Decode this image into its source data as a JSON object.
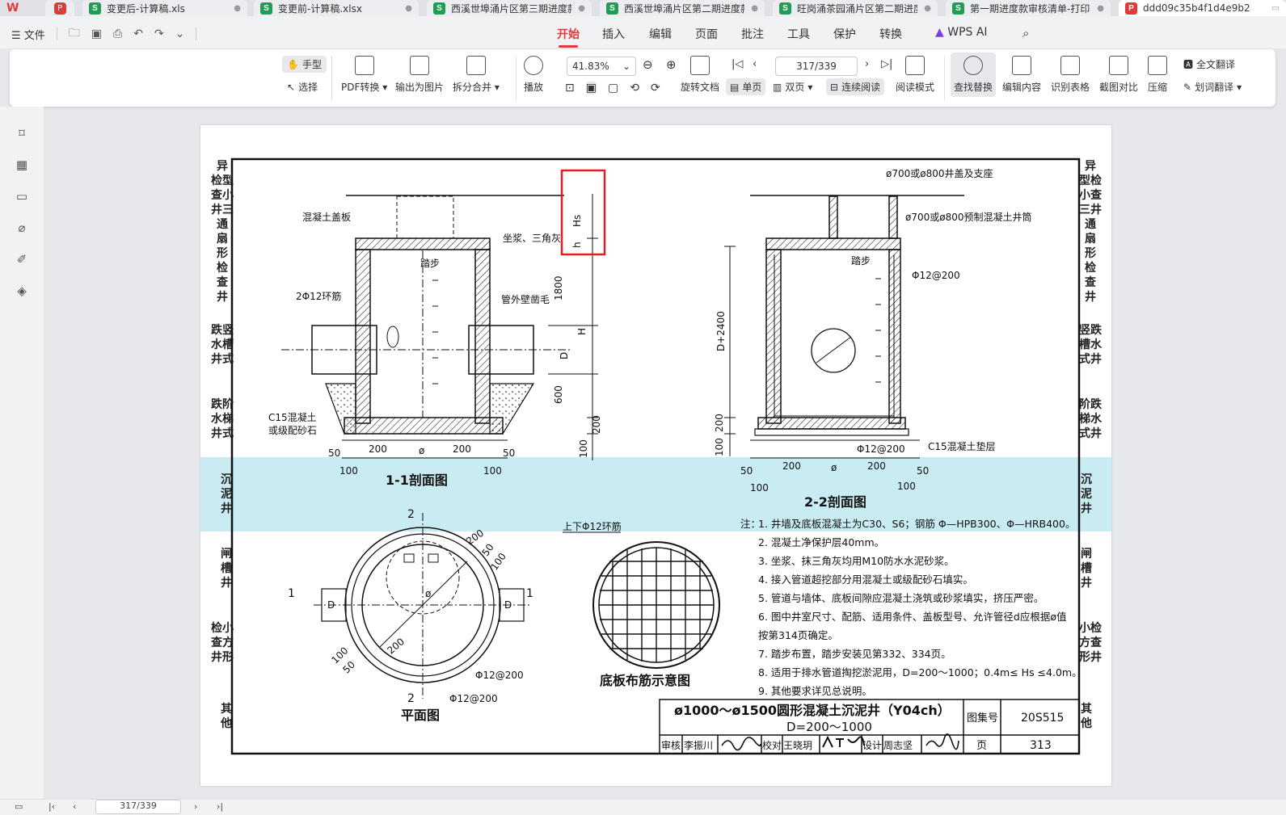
{
  "tabs": [
    {
      "label": "变更后-计算稿.xls",
      "type": "s"
    },
    {
      "label": "变更前-计算稿.xlsx",
      "type": "s"
    },
    {
      "label": "西溪世埠涌片区第三期进度款",
      "type": "s"
    },
    {
      "label": "西溪世埠涌片区第二期进度款计",
      "type": "s"
    },
    {
      "label": "旺岗涌茶园涌片区第二期进度款",
      "type": "s"
    },
    {
      "label": "第一期进度款审核清单-打印.",
      "type": "s"
    },
    {
      "label": "ddd09c35b4f1d4e9b2",
      "type": "p"
    }
  ],
  "menu": {
    "file_label": "文件",
    "tabs": [
      "开始",
      "插入",
      "编辑",
      "页面",
      "批注",
      "工具",
      "保护",
      "转换"
    ],
    "active_tab": "开始",
    "wps_ai": "WPS AI"
  },
  "ribbon": {
    "hand": "手型",
    "select": "选择",
    "pdf_convert": "PDF转换",
    "export_image": "输出为图片",
    "split_merge": "拆分合并",
    "play": "播放",
    "zoom": "41.83%",
    "rotate": "旋转文档",
    "single_page": "单页",
    "double_page": "双页",
    "continuous": "连续阅读",
    "read_mode": "阅读模式",
    "page_indicator": "317/339",
    "find_replace": "查找替换",
    "edit_content": "编辑内容",
    "recognize_table": "识别表格",
    "screenshot_compare": "截图对比",
    "compress": "压缩",
    "full_translate": "全文翻译",
    "word_translate": "划词翻译"
  },
  "sidebar_icons": [
    "bookmark-icon",
    "thumbnail-icon",
    "comment-icon",
    "attachment-icon",
    "signature-icon",
    "layers-icon"
  ],
  "side_left": [
    {
      "text": "异\n检型\n查小\n井三\n通\n扇\n形\n检\n查\n井"
    },
    {
      "text": "跌竖\n水槽\n井式"
    },
    {
      "text": "跌阶\n水梯\n井式"
    },
    {
      "text": "沉\n泥\n井"
    },
    {
      "text": "闸\n槽\n井"
    },
    {
      "text": "检小\n查方\n井形"
    },
    {
      "text": "其\n他"
    }
  ],
  "side_right": [
    {
      "text": "异\n型检\n小查\n三井\n通\n扇\n形\n检\n查\n井"
    },
    {
      "text": "竖跌\n槽水\n式井"
    },
    {
      "text": "阶跌\n梯水\n式井"
    },
    {
      "text": "沉\n泥\n井"
    },
    {
      "text": "闸\n槽\n井"
    },
    {
      "text": "小检\n方查\n形井"
    },
    {
      "text": "其\n他"
    }
  ],
  "drawing": {
    "sec11_title": "1-1剖面图",
    "sec22_title": "2-2剖面图",
    "plan_title": "平面图",
    "rebar_title": "底板布筋示意图",
    "labels": {
      "cover_plate": "混凝土盖板",
      "mortar": "坐浆、三角灰",
      "step": "踏步",
      "ring_bar": "2Φ12环筋",
      "wall_rough": "管外壁凿毛",
      "c15_left": "C15混凝土",
      "gravel": "或级配砂石",
      "lid": "ø700或ø800井盖及支座",
      "neck": "ø700或ø800预制混凝土井筒",
      "step2": "踏步",
      "bar_200": "Φ12@200",
      "bar_200b": "Φ12@200",
      "c15_right": "C15混凝土垫层",
      "ring_updown": "上下Φ12环筋",
      "bar_plan1": "Φ12@200",
      "bar_plan2": "Φ12@200"
    },
    "dims": {
      "d1800": "1800",
      "dH": "H",
      "dD": "D",
      "d600": "600",
      "d200": "200",
      "d100": "100",
      "hs": "Hs",
      "h": "h",
      "dD2400": "D+2400",
      "d200b": "200",
      "d100b": "100",
      "bot": [
        "50",
        "200",
        "ø",
        "200",
        "50"
      ],
      "bot2": [
        "100",
        "100"
      ],
      "bot22": [
        "50",
        "200",
        "ø",
        "200",
        "50"
      ],
      "bot22b": [
        "100",
        "100"
      ],
      "plan": [
        "200",
        "50",
        "100",
        "100",
        "50",
        "200"
      ],
      "sec1": "1",
      "sec2": "2",
      "phi": "ø",
      "D": "D"
    },
    "notes_title": "注：",
    "notes": [
      "1. 井墙及底板混凝土为C30、S6；钢筋 Φ—HPB300、Φ—HRB400。",
      "2. 混凝土净保护层40mm。",
      "3. 坐浆、抹三角灰均用M10防水水泥砂浆。",
      "4. 接入管道超挖部分用混凝土或级配砂石填实。",
      "5. 管道与墙体、底板间隙应混凝土浇筑或砂浆填实，挤压严密。",
      "6. 图中井室尺寸、配筋、适用条件、盖板型号、允许管径d应根据ø值",
      "   按第314页确定。",
      "7. 踏步布置，踏步安装见第332、334页。",
      "8. 适用于排水管道掏挖淤泥用，D=200～1000；0.4m≤ Hs ≤4.0m。",
      "9. 其他要求详见总说明。"
    ],
    "titleblock": {
      "title1": "ø1000～ø1500圆形混凝土沉泥井（Y04ch）",
      "title2": "D=200～1000",
      "atlas_label": "图集号",
      "atlas_no": "20S515",
      "page_label": "页",
      "page_no": "313",
      "review": "审核",
      "reviewer": "李振川",
      "check": "校对",
      "checker": "王晓玥",
      "design": "设计",
      "designer": "周志坚"
    }
  },
  "status": {
    "page": "317/339"
  }
}
